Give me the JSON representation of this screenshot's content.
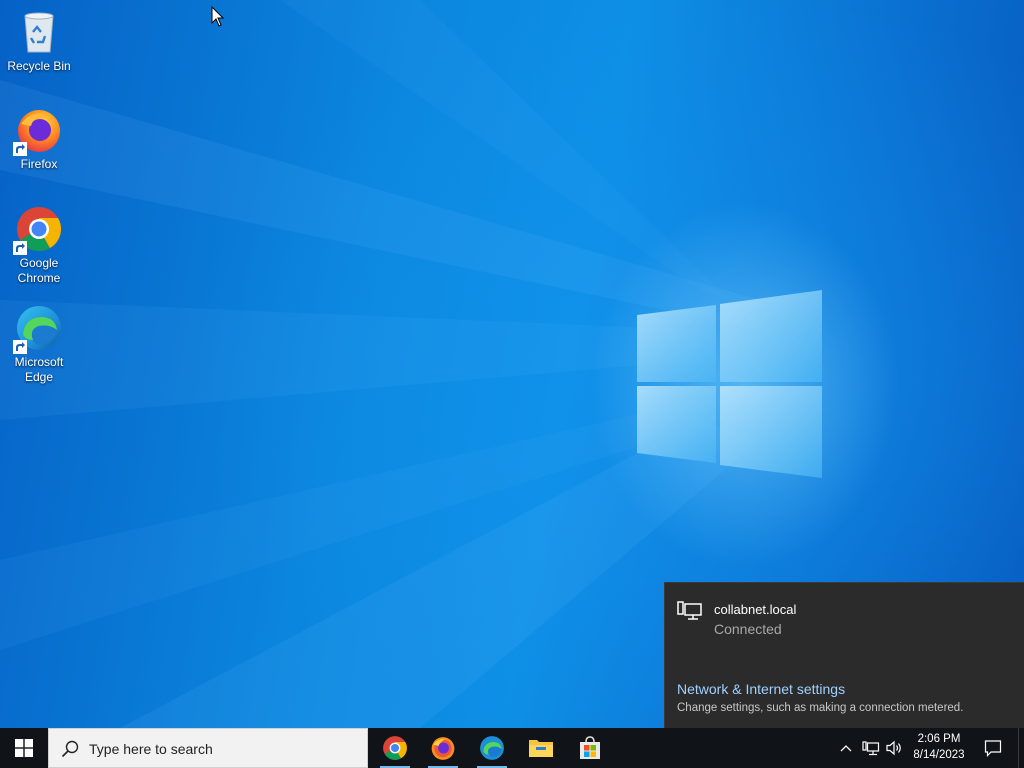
{
  "desktop": {
    "icons": [
      {
        "label": "Recycle Bin"
      },
      {
        "label": "Firefox"
      },
      {
        "label": "Google\nChrome"
      },
      {
        "label": "Microsoft\nEdge"
      }
    ]
  },
  "network_flyout": {
    "network_name": "collabnet.local",
    "status": "Connected",
    "settings_link": "Network & Internet settings",
    "settings_description": "Change settings, such as making a connection metered."
  },
  "taskbar": {
    "search_placeholder": "Type here to search",
    "pinned_apps": [
      "chrome-icon",
      "firefox-icon",
      "edge-icon",
      "file-explorer-icon",
      "microsoft-store-icon"
    ],
    "clock": {
      "time": "2:06 PM",
      "date": "8/14/2023"
    }
  },
  "colors": {
    "taskbar": "#101418",
    "flyout_bg": "#2b2b2b",
    "link": "#9fd0ff",
    "running_indicator": "#76b9ed"
  }
}
